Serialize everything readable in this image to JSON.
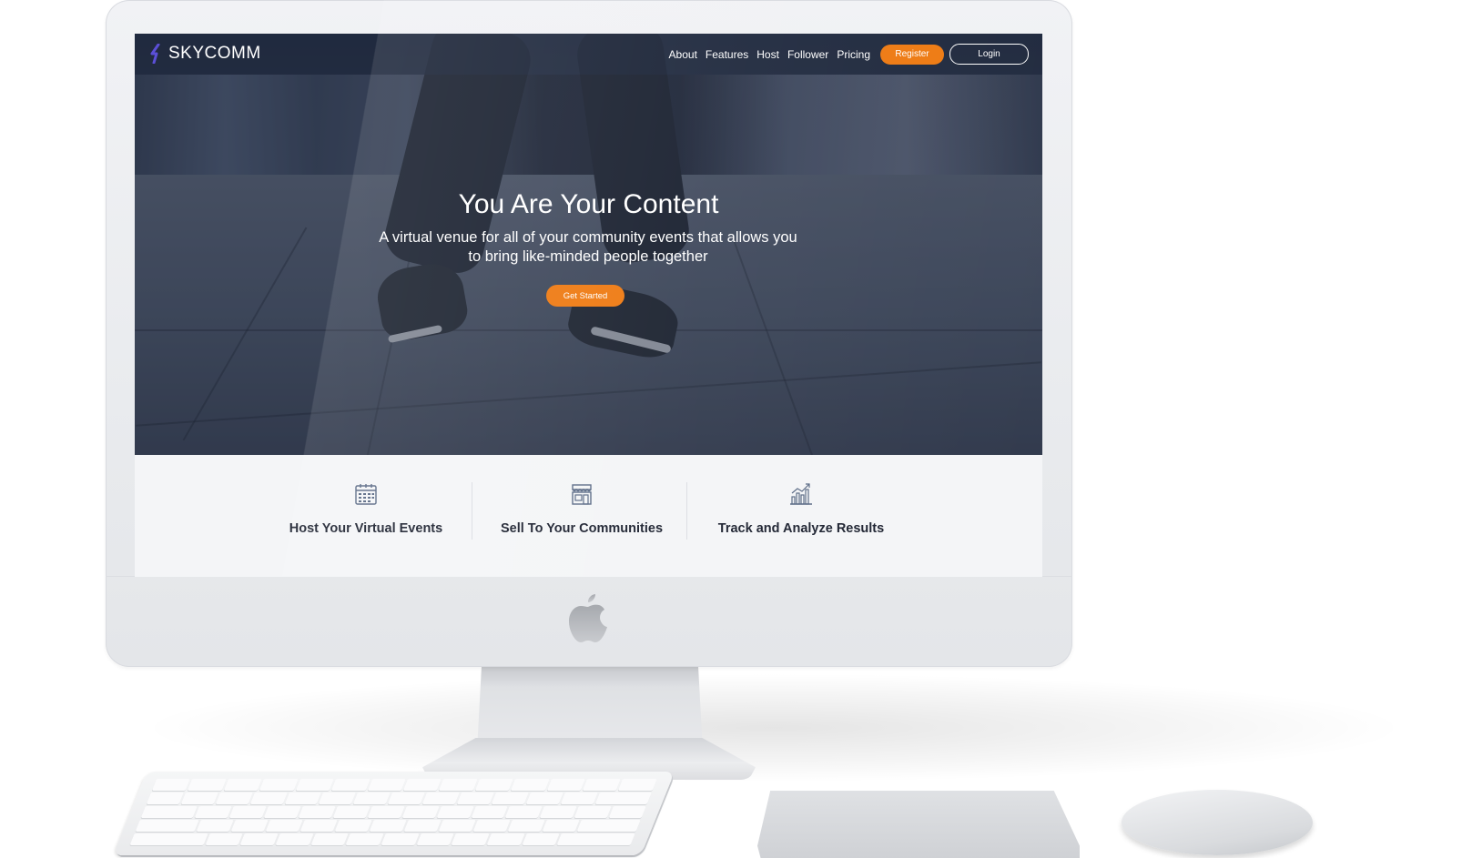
{
  "brand": {
    "name": "SKYCOMM"
  },
  "nav": {
    "links": [
      "About",
      "Features",
      "Host",
      "Follower",
      "Pricing"
    ],
    "register_label": "Register",
    "login_label": "Login"
  },
  "hero": {
    "title": "You Are Your Content",
    "subtitle": "A virtual venue for all of your community events that allows you to bring like-minded people together",
    "cta_label": "Get Started"
  },
  "features": [
    {
      "label": "Host Your Virtual Events",
      "icon": "calendar-icon"
    },
    {
      "label": "Sell To Your Communities",
      "icon": "storefront-icon"
    },
    {
      "label": "Track and Analyze Results",
      "icon": "bar-chart-icon"
    }
  ],
  "colors": {
    "accent": "#ee7a12",
    "nav_bg": "#1e283e",
    "feature_text": "#1d2230",
    "icon_color": "#5a6a85"
  }
}
